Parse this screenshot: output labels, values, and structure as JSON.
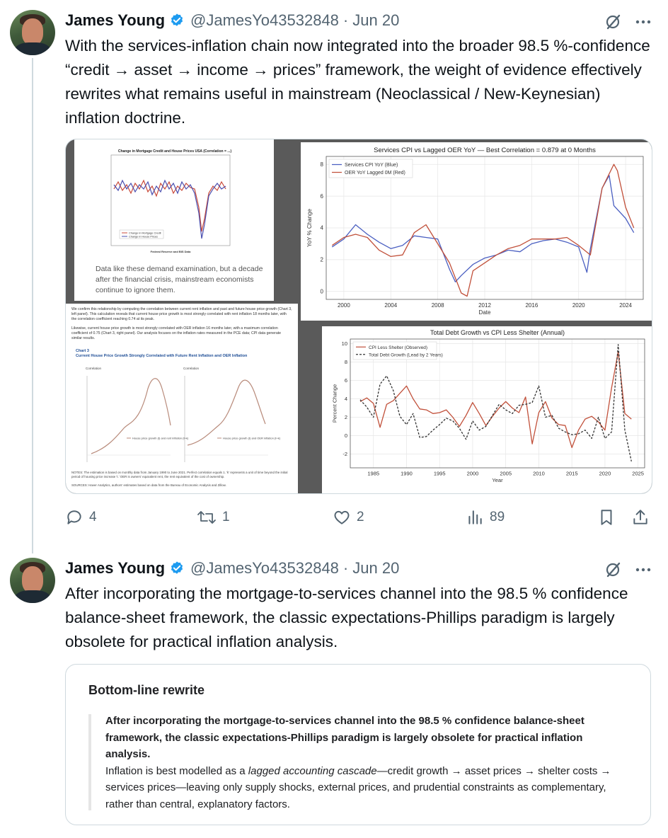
{
  "tweet1": {
    "name": "James Young",
    "handle": "@JamesYo43532848",
    "date": "Jun 20",
    "text": "With the services-inflation chain now integrated into the broader 98.5 %-confidence “credit → asset → income → prices” framework, the weight of evidence effectively rewrites what remains useful in mainstream (Neoclassical / New-Keynesian) inflation doctrine.",
    "media": {
      "panel1": {
        "title": "Change in Mortgage Credit and House Prices USA (Correlation = ...)",
        "caption": "Data like these demand examination, but a decade after the financial crisis, mainstream economists continue to ignore them.",
        "legend": [
          "Change in Mortgage Credit",
          "Change in House Prices"
        ],
        "source": "Federal Reserve and BIS Data"
      },
      "panel2": {
        "chart_data": {
          "type": "line",
          "title": "Services CPI vs Lagged OER YoY — Best Correlation = 0.879 at 0 Months",
          "xlabel": "Date",
          "ylabel": "YoY % Change",
          "xlim": [
            1998.5,
            2025.5
          ],
          "ylim": [
            -0.5,
            8.5
          ],
          "xticks": [
            2000,
            2004,
            2008,
            2012,
            2016,
            2020,
            2024
          ],
          "yticks": [
            0,
            2,
            4,
            6,
            8
          ],
          "legend_position": "top-left",
          "grid": true,
          "series": [
            {
              "name": "Services CPI YoY (Blue)",
              "color": "#4a5fc1",
              "x": [
                1999,
                2000,
                2001,
                2002,
                2003,
                2004,
                2005,
                2006,
                2007,
                2008,
                2009,
                2009.5,
                2010,
                2011,
                2012,
                2013,
                2014,
                2015,
                2016,
                2017,
                2018,
                2019,
                2020,
                2020.7,
                2021,
                2022,
                2022.6,
                2023,
                2024,
                2024.7
              ],
              "y": [
                2.8,
                3.3,
                4.2,
                3.6,
                3.1,
                2.7,
                2.9,
                3.5,
                3.4,
                3.3,
                1.4,
                0.6,
                1.0,
                1.7,
                2.1,
                2.3,
                2.6,
                2.5,
                3.0,
                3.2,
                3.3,
                3.1,
                2.8,
                1.2,
                2.7,
                6.5,
                7.3,
                5.4,
                4.6,
                3.7
              ]
            },
            {
              "name": "OER YoY Lagged 0M (Red)",
              "color": "#c1503a",
              "x": [
                1999,
                2000,
                2001,
                2002,
                2003,
                2004,
                2005,
                2006,
                2007,
                2008,
                2009,
                2010,
                2010.5,
                2011,
                2012,
                2013,
                2014,
                2015,
                2016,
                2017,
                2018,
                2019,
                2020,
                2021,
                2022,
                2023,
                2023.3,
                2024,
                2024.7
              ],
              "y": [
                2.9,
                3.4,
                3.6,
                3.4,
                2.6,
                2.2,
                2.3,
                3.7,
                4.2,
                3.0,
                1.8,
                -0.1,
                -0.3,
                1.3,
                1.8,
                2.3,
                2.7,
                2.9,
                3.3,
                3.3,
                3.3,
                3.4,
                2.9,
                2.3,
                6.5,
                8.0,
                7.6,
                5.3,
                4.0
              ]
            }
          ]
        }
      },
      "panel3": {
        "intro": "We confirm this relationship by computing the correlation between current rent inflation and past and future house price growth (Chart 3, left panel). This calculation reveals that current house price growth is most strongly correlated with rent inflation 18 months later, with the correlation coefficient reaching 0.74 at its peak.",
        "intro2": "Likewise, current house price growth is most strongly correlated with OER inflation 16 months later, with a maximum correlation coefficient of 0.75 (Chart 3, right panel). Our analysis focuses on the inflation rates measured in the PCE data; CPI data generate similar results.",
        "chart_label": "Chart 3",
        "chart_title": "Current House Price Growth Strongly Correlated with Future Rent Inflation and OER Inflation",
        "axis_label": "Correlation",
        "left_legend": "House price growth (t) and rent inflation (t+k)",
        "right_legend": "House price growth (t) and OER inflation (t+k)",
        "notes": "NOTES: The estimation is based on monthly data from January 1990 to June 2021. Perfect correlation equals 1. 'k' represents a unit of time beyond the initial period of housing price increase 't.' OER is owners' equivalent rent, the rent equivalent of the cost of ownership.",
        "sources": "SOURCES: Haver Analytics, authors' estimates based on data from the Bureau of Economic Analysis and Zillow."
      },
      "panel4": {
        "chart_data": {
          "type": "line",
          "title": "Total Debt Growth vs CPI Less Shelter (Annual)",
          "xlabel": "Year",
          "ylabel": "Percent Change",
          "xlim": [
            1981.5,
            2026
          ],
          "ylim": [
            -3.5,
            10.5
          ],
          "xticks": [
            1985,
            1990,
            1995,
            2000,
            2005,
            2010,
            2015,
            2020,
            2025
          ],
          "yticks": [
            -2,
            0,
            2,
            4,
            6,
            8,
            10
          ],
          "legend_position": "top-left",
          "grid": true,
          "series": [
            {
              "name": "CPI Less Shelter (Observed)",
              "color": "#c1503a",
              "dash": "solid",
              "x": [
                1983,
                1984,
                1985,
                1986,
                1987,
                1988,
                1989,
                1990,
                1991,
                1992,
                1993,
                1994,
                1995,
                1996,
                1997,
                1998,
                1999,
                2000,
                2001,
                2002,
                2003,
                2004,
                2005,
                2006,
                2007,
                2008,
                2009,
                2010,
                2011,
                2012,
                2013,
                2014,
                2015,
                2016,
                2017,
                2018,
                2019,
                2020,
                2021,
                2022,
                2023,
                2024
              ],
              "y": [
                3.7,
                4.1,
                3.5,
                0.9,
                3.4,
                3.8,
                4.6,
                5.4,
                4.0,
                2.9,
                2.8,
                2.4,
                2.5,
                2.8,
                2.0,
                1.0,
                2.2,
                3.6,
                2.4,
                1.1,
                2.1,
                3.0,
                3.7,
                3.0,
                2.5,
                4.2,
                -0.9,
                2.5,
                3.7,
                1.9,
                1.2,
                1.1,
                -1.3,
                0.6,
                1.8,
                2.1,
                1.5,
                0.6,
                5.2,
                9.1,
                2.4,
                1.8
              ]
            },
            {
              "name": "Total Debt Growth (Lead by 2 Years)",
              "color": "#333333",
              "dash": "dashed",
              "x": [
                1983,
                1984,
                1985,
                1986,
                1987,
                1988,
                1989,
                1990,
                1991,
                1992,
                1993,
                1994,
                1995,
                1996,
                1997,
                1998,
                1999,
                2000,
                2001,
                2002,
                2003,
                2004,
                2005,
                2006,
                2007,
                2008,
                2009,
                2010,
                2011,
                2012,
                2013,
                2014,
                2015,
                2016,
                2017,
                2018,
                2019,
                2020,
                2021,
                2022,
                2023,
                2024
              ],
              "y": [
                3.9,
                3.1,
                2.0,
                5.6,
                6.5,
                4.9,
                2.1,
                1.2,
                2.4,
                -0.2,
                -0.1,
                0.6,
                1.2,
                1.9,
                1.6,
                0.8,
                -0.4,
                1.6,
                0.6,
                1.0,
                2.2,
                3.4,
                2.8,
                2.4,
                3.3,
                3.4,
                3.6,
                5.4,
                2.0,
                2.2,
                0.8,
                0.4,
                0.1,
                0.2,
                0.6,
                -0.3,
                2.0,
                -0.3,
                0.4,
                9.9,
                0.6,
                -2.8
              ]
            }
          ]
        }
      }
    },
    "stats": {
      "replies": "4",
      "reposts": "1",
      "likes": "2",
      "views": "89"
    }
  },
  "tweet2": {
    "name": "James Young",
    "handle": "@JamesYo43532848",
    "date": "Jun 20",
    "text": "After incorporating the mortgage-to-services channel into the 98.5 % confidence balance-sheet framework, the classic expectations-Phillips paradigm is largely obsolete for practical inflation analysis.",
    "quote": {
      "title": "Bottom-line rewrite",
      "bold": "After incorporating the mortgage-to-services channel into the 98.5 % confidence balance-sheet framework, the classic expectations-Phillips paradigm is largely obsolete for practical inflation analysis.",
      "line_prefix": "Inflation is best modelled as a ",
      "line_italic": "lagged accounting cascade",
      "line_rest": "—credit growth → asset prices → shelter costs → services prices—leaving only supply shocks, external prices, and prudential constraints as complementary, rather than central, explanatory factors."
    }
  },
  "colors": {
    "verified": "#1d9bf0",
    "muted": "#536471",
    "border": "#cfd9de"
  }
}
